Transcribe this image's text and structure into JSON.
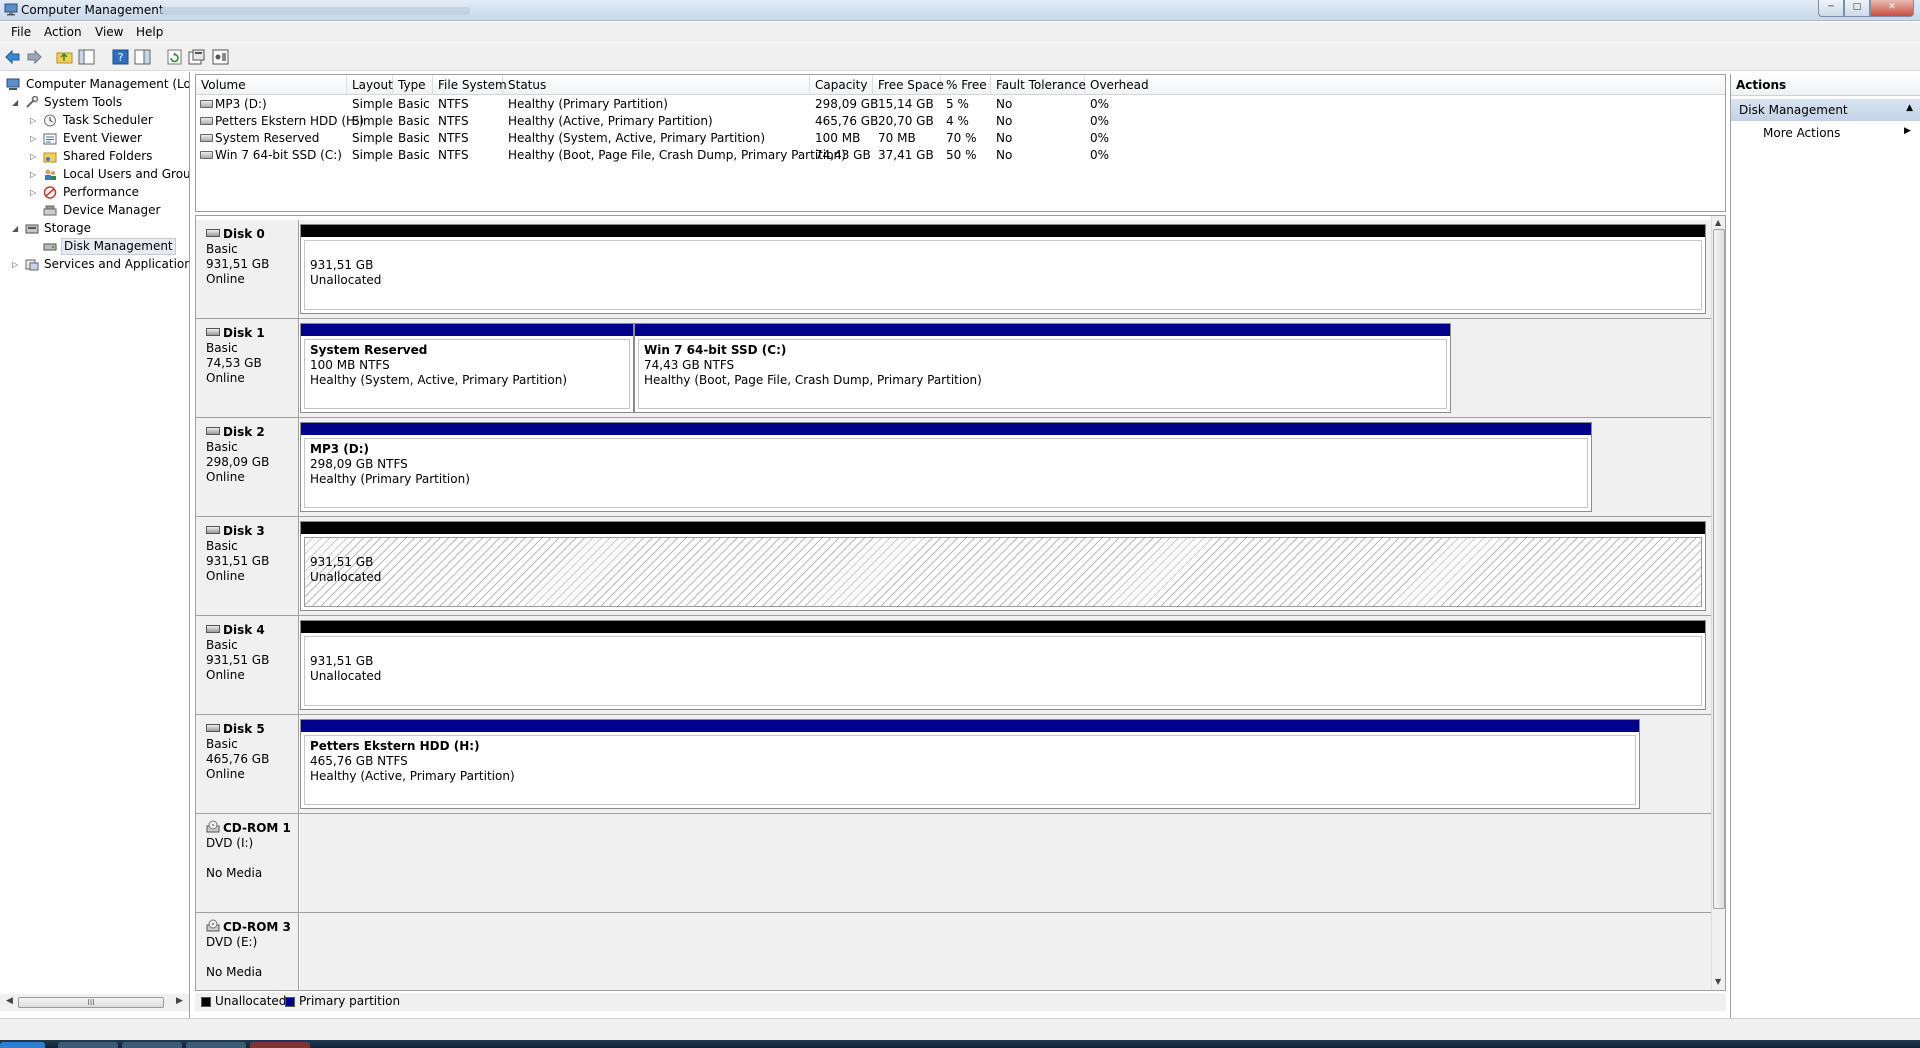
{
  "window": {
    "title": "Computer Management"
  },
  "menu": [
    "File",
    "Action",
    "View",
    "Help"
  ],
  "toolbar": {
    "icons": [
      "back-arrow-icon",
      "forward-arrow-icon",
      "up-folder-icon",
      "console-tree-icon",
      "help-icon",
      "show-hide-pane-icon",
      "refresh-icon",
      "properties-icon",
      "settings-icon"
    ]
  },
  "tree": {
    "root": "Computer Management (Local",
    "items": [
      {
        "label": "System Tools",
        "level": 1,
        "expanded": true
      },
      {
        "label": "Task Scheduler",
        "level": 2
      },
      {
        "label": "Event Viewer",
        "level": 2
      },
      {
        "label": "Shared Folders",
        "level": 2
      },
      {
        "label": "Local Users and Groups",
        "level": 2
      },
      {
        "label": "Performance",
        "level": 2
      },
      {
        "label": "Device Manager",
        "level": 2
      },
      {
        "label": "Storage",
        "level": 1,
        "expanded": true
      },
      {
        "label": "Disk Management",
        "level": 2,
        "selected": true
      },
      {
        "label": "Services and Applications",
        "level": 1
      }
    ],
    "scroll_grip": "III"
  },
  "volume_list": {
    "columns": [
      "Volume",
      "Layout",
      "Type",
      "File System",
      "Status",
      "Capacity",
      "Free Space",
      "% Free",
      "Fault Tolerance",
      "Overhead"
    ],
    "rows": [
      [
        "MP3 (D:)",
        "Simple",
        "Basic",
        "NTFS",
        "Healthy (Primary Partition)",
        "298,09 GB",
        "15,14 GB",
        "5 %",
        "No",
        "0%"
      ],
      [
        "Petters Ekstern HDD (H:)",
        "Simple",
        "Basic",
        "NTFS",
        "Healthy (Active, Primary Partition)",
        "465,76 GB",
        "20,70 GB",
        "4 %",
        "No",
        "0%"
      ],
      [
        "System Reserved",
        "Simple",
        "Basic",
        "NTFS",
        "Healthy (System, Active, Primary Partition)",
        "100 MB",
        "70 MB",
        "70 %",
        "No",
        "0%"
      ],
      [
        "Win 7 64-bit SSD (C:)",
        "Simple",
        "Basic",
        "NTFS",
        "Healthy (Boot, Page File, Crash Dump, Primary Partition)",
        "74,43 GB",
        "37,41 GB",
        "50 %",
        "No",
        "0%"
      ]
    ]
  },
  "disks": [
    {
      "name": "Disk 0",
      "type": "Basic",
      "size": "931,51 GB",
      "state": "Online",
      "partitions": [
        {
          "kind": "unallocated",
          "size": "931,51 GB",
          "label": "Unallocated"
        }
      ]
    },
    {
      "name": "Disk 1",
      "type": "Basic",
      "size": "74,53 GB",
      "state": "Online",
      "partitions": [
        {
          "kind": "primary",
          "name": "System Reserved",
          "fs": "100 MB NTFS",
          "status": "Healthy (System, Active, Primary Partition)"
        },
        {
          "kind": "primary",
          "name": "Win 7 64-bit SSD  (C:)",
          "fs": "74,43 GB NTFS",
          "status": "Healthy (Boot, Page File, Crash Dump, Primary Partition)"
        }
      ]
    },
    {
      "name": "Disk 2",
      "type": "Basic",
      "size": "298,09 GB",
      "state": "Online",
      "partitions": [
        {
          "kind": "primary",
          "name": "MP3  (D:)",
          "fs": "298,09 GB NTFS",
          "status": "Healthy (Primary Partition)"
        }
      ]
    },
    {
      "name": "Disk 3",
      "type": "Basic",
      "size": "931,51 GB",
      "state": "Online",
      "partitions": [
        {
          "kind": "unallocated",
          "size": "931,51 GB",
          "label": "Unallocated",
          "selected": true
        }
      ]
    },
    {
      "name": "Disk 4",
      "type": "Basic",
      "size": "931,51 GB",
      "state": "Online",
      "partitions": [
        {
          "kind": "unallocated",
          "size": "931,51 GB",
          "label": "Unallocated"
        }
      ]
    },
    {
      "name": "Disk 5",
      "type": "Basic",
      "size": "465,76 GB",
      "state": "Online",
      "partitions": [
        {
          "kind": "primary",
          "name": "Petters Ekstern HDD  (H:)",
          "fs": "465,76 GB NTFS",
          "status": "Healthy (Active, Primary Partition)"
        }
      ]
    }
  ],
  "cdroms": [
    {
      "name": "CD-ROM 1",
      "drive": "DVD (I:)",
      "media": "No Media"
    },
    {
      "name": "CD-ROM 3",
      "drive": "DVD (E:)",
      "media": "No Media"
    }
  ],
  "legend": [
    {
      "label": "Unallocated",
      "color": "#000000"
    },
    {
      "label": "Primary partition",
      "color": "#00008b"
    }
  ],
  "actions": {
    "header": "Actions",
    "section": "Disk Management",
    "more": "More Actions"
  },
  "colors": {
    "unallocated": "#000000",
    "primary": "#00008b",
    "selection": "#c3d2e6"
  }
}
